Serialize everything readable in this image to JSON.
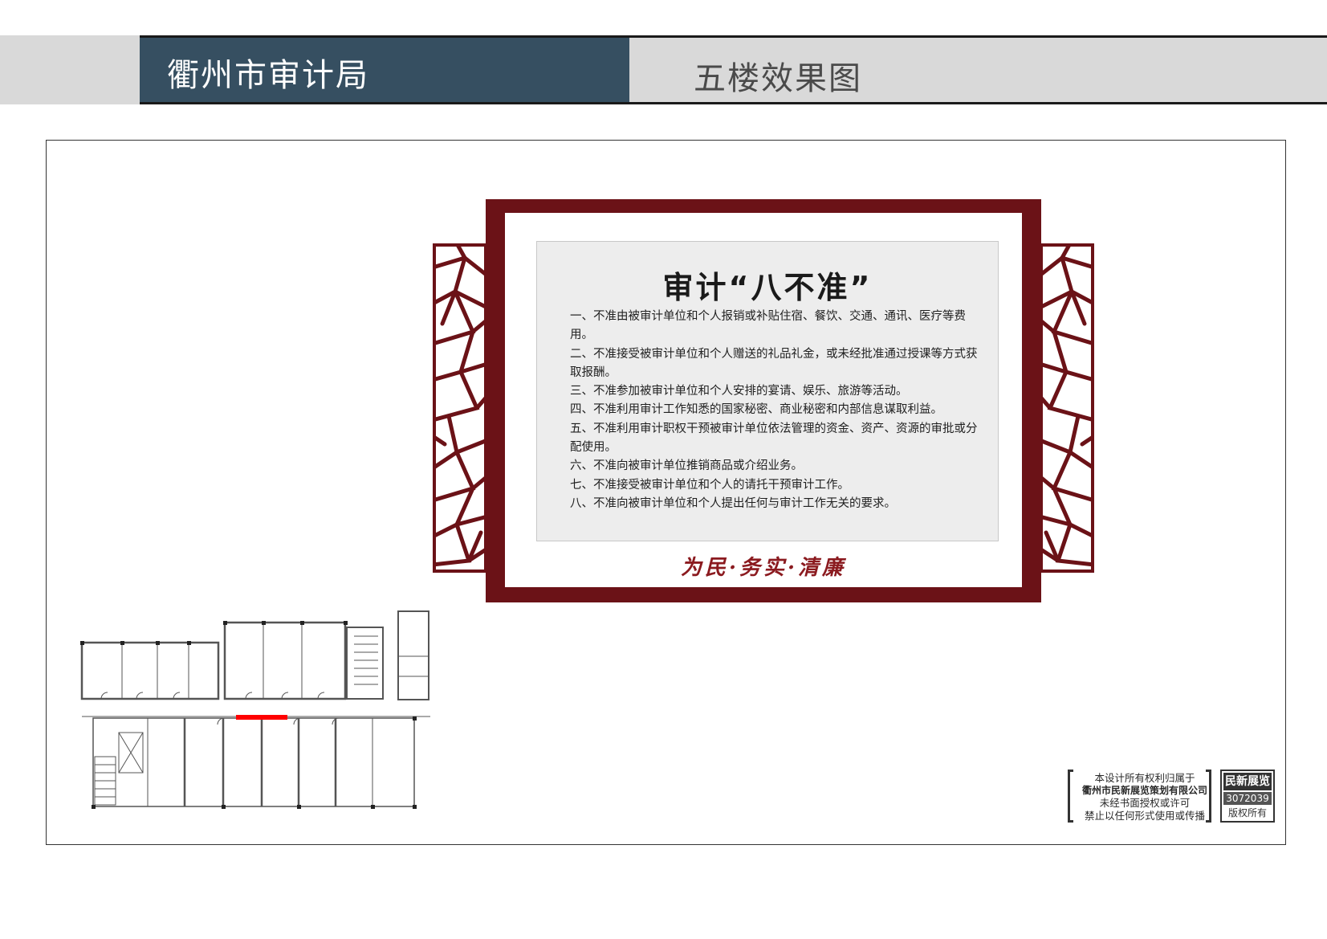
{
  "header": {
    "title": "衢州市审计局",
    "subtitle": "五楼效果图"
  },
  "board": {
    "title": "审计“八不准”",
    "rules": [
      "一、不准由被审计单位和个人报销或补贴住宿、餐饮、交通、通讯、医疗等费用。",
      "二、不准接受被审计单位和个人赠送的礼品礼金，或未经批准通过授课等方式获取报酬。",
      "三、不准参加被审计单位和个人安排的宴请、娱乐、旅游等活动。",
      "四、不准利用审计工作知悉的国家秘密、商业秘密和内部信息谋取利益。",
      "五、不准利用审计职权干预被审计单位依法管理的资金、资产、资源的审批或分配使用。",
      "六、不准向被审计单位推销商品或介绍业务。",
      "七、不准接受被审计单位和个人的请托干预审计工作。",
      "八、不准向被审计单位和个人提出任何与审计工作无关的要求。"
    ],
    "motto": "为民·务实·清廉"
  },
  "colors": {
    "header_dark": "#364f61",
    "header_gray": "#d9d9d9",
    "board_red": "#6b1217",
    "highlight_red": "#ff0000"
  },
  "copyright": {
    "line1": "本设计所有权利归属于",
    "line2": "衢州市民新展览策划有限公司",
    "line3": "未经书面授权或许可",
    "line4": "禁止以任何形式使用或传播",
    "brand": "民新展览",
    "code": "3072039",
    "rights": "版权所有"
  }
}
